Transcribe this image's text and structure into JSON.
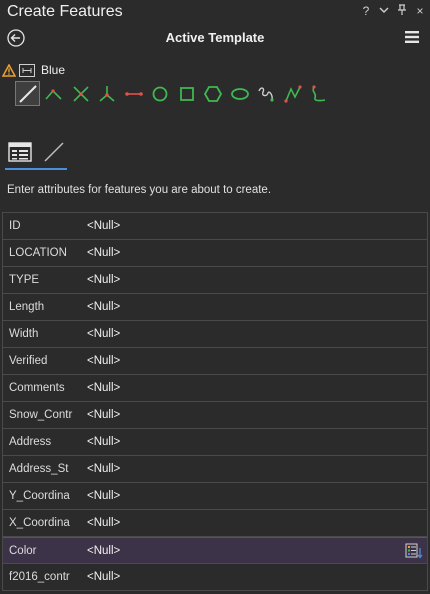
{
  "window": {
    "title": "Create Features",
    "controls": [
      "?",
      "⌄",
      "⊥",
      "×"
    ]
  },
  "header": {
    "title": "Active Template"
  },
  "template": {
    "name": "Blue"
  },
  "tools": [
    {
      "name": "line-tool-icon",
      "active": true
    },
    {
      "name": "right-angle-line-icon"
    },
    {
      "name": "midpoint-icon"
    },
    {
      "name": "endpoint-arc-icon"
    },
    {
      "name": "two-point-line-icon"
    },
    {
      "name": "circle-icon"
    },
    {
      "name": "rectangle-icon"
    },
    {
      "name": "polygon-icon"
    },
    {
      "name": "ellipse-icon"
    },
    {
      "name": "freehand-icon"
    },
    {
      "name": "trace-icon"
    },
    {
      "name": "stream-icon"
    }
  ],
  "instructions": "Enter attributes for features you are about to create.",
  "attributes": [
    {
      "name": "ID",
      "value": "<Null>"
    },
    {
      "name": "LOCATION",
      "value": "<Null>"
    },
    {
      "name": "TYPE",
      "value": "<Null>"
    },
    {
      "name": "Length",
      "value": "<Null>"
    },
    {
      "name": "Width",
      "value": "<Null>"
    },
    {
      "name": "Verified",
      "value": "<Null>"
    },
    {
      "name": "Comments",
      "value": "<Null>"
    },
    {
      "name": "Snow_Contr",
      "value": "<Null>"
    },
    {
      "name": "Address",
      "value": "<Null>"
    },
    {
      "name": "Address_St",
      "value": "<Null>"
    },
    {
      "name": "Y_Coordina",
      "value": "<Null>"
    },
    {
      "name": "X_Coordina",
      "value": "<Null>"
    },
    {
      "name": "Color",
      "value": "<Null>",
      "selected": true
    },
    {
      "name": "f2016_contr",
      "value": "<Null>"
    }
  ],
  "colors": {
    "accent": "#4a90d9",
    "selected_row": "#3d3348",
    "warning": "#f0a030",
    "tool_green": "#3fb950",
    "tool_red": "#e0524a"
  }
}
